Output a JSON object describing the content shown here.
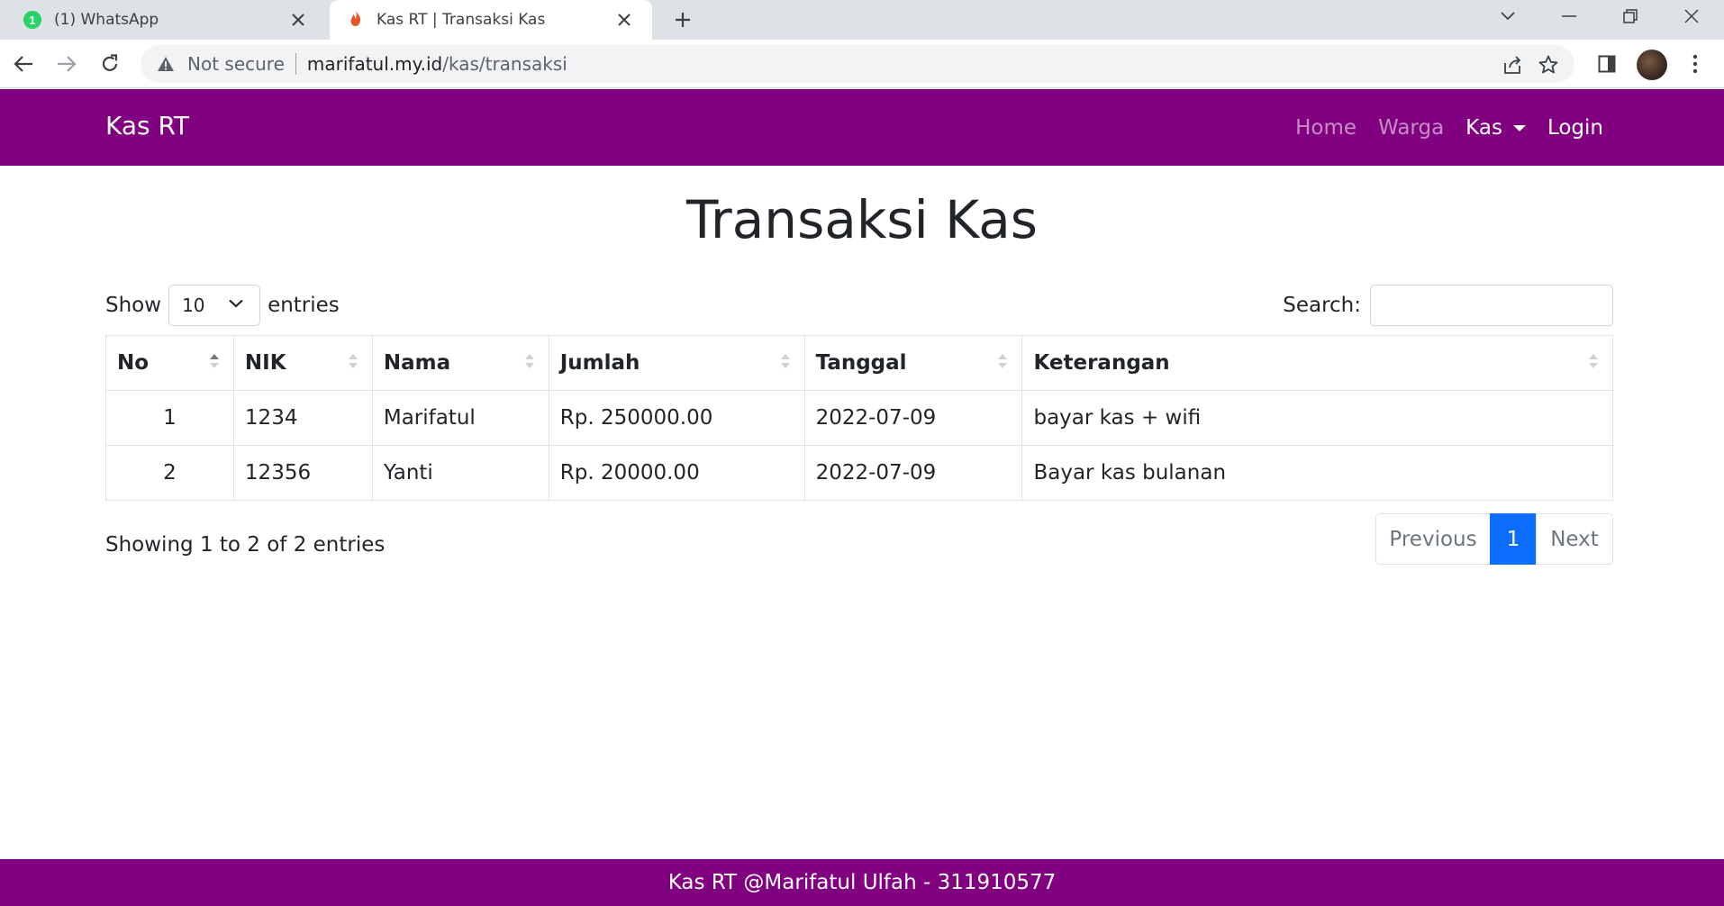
{
  "browser": {
    "tabs": [
      {
        "badge": "1",
        "title": "(1) WhatsApp"
      },
      {
        "title": "Kas RT | Transaksi Kas"
      }
    ],
    "address": {
      "security": "Not secure",
      "host": "marifatul.my.id",
      "path": "/kas/transaksi"
    }
  },
  "navbar": {
    "brand": "Kas RT",
    "links": [
      "Home",
      "Warga",
      "Kas",
      "Login"
    ]
  },
  "page": {
    "title": "Transaksi Kas"
  },
  "controls": {
    "show_label": "Show",
    "length_value": "10",
    "entries_label": "entries",
    "search_label": "Search:",
    "search_value": ""
  },
  "table": {
    "columns": [
      "No",
      "NIK",
      "Nama",
      "Jumlah",
      "Tanggal",
      "Keterangan"
    ],
    "rows": [
      [
        "1",
        "1234",
        "Marifatul",
        "Rp. 250000.00",
        "2022-07-09",
        "bayar kas + wifi"
      ],
      [
        "2",
        "12356",
        "Yanti",
        "Rp. 20000.00",
        "2022-07-09",
        "Bayar kas bulanan"
      ]
    ]
  },
  "info": "Showing 1 to 2 of 2 entries",
  "pagination": {
    "previous": "Previous",
    "current": "1",
    "next": "Next"
  },
  "footer": "Kas RT @Marifatul Ulfah - 311910577",
  "colors": {
    "brand_purple": "#800080",
    "page_active_blue": "#0d6efd"
  }
}
